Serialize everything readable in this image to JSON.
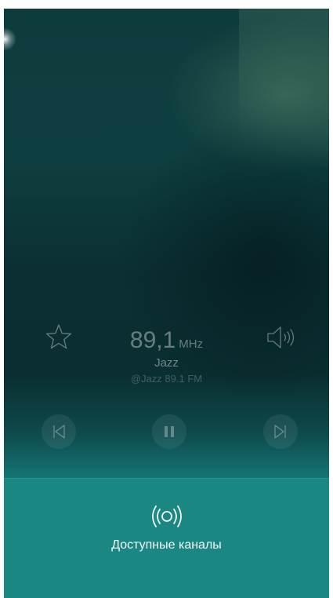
{
  "player": {
    "frequency": "89,1",
    "unit": "MHz",
    "station_genre": "Jazz",
    "station_handle": "@Jazz 89.1 FM",
    "icons": [
      "star-icon",
      "speaker-icon",
      "previous-icon",
      "pause-icon",
      "next-icon"
    ]
  },
  "bottom_bar": {
    "label": "Доступные каналы",
    "icon": "radio-waves-icon"
  },
  "colors": {
    "background_top": "#0d3c3d",
    "background_bottom": "#1a8f8b",
    "bottom_panel": "#1a8783"
  }
}
